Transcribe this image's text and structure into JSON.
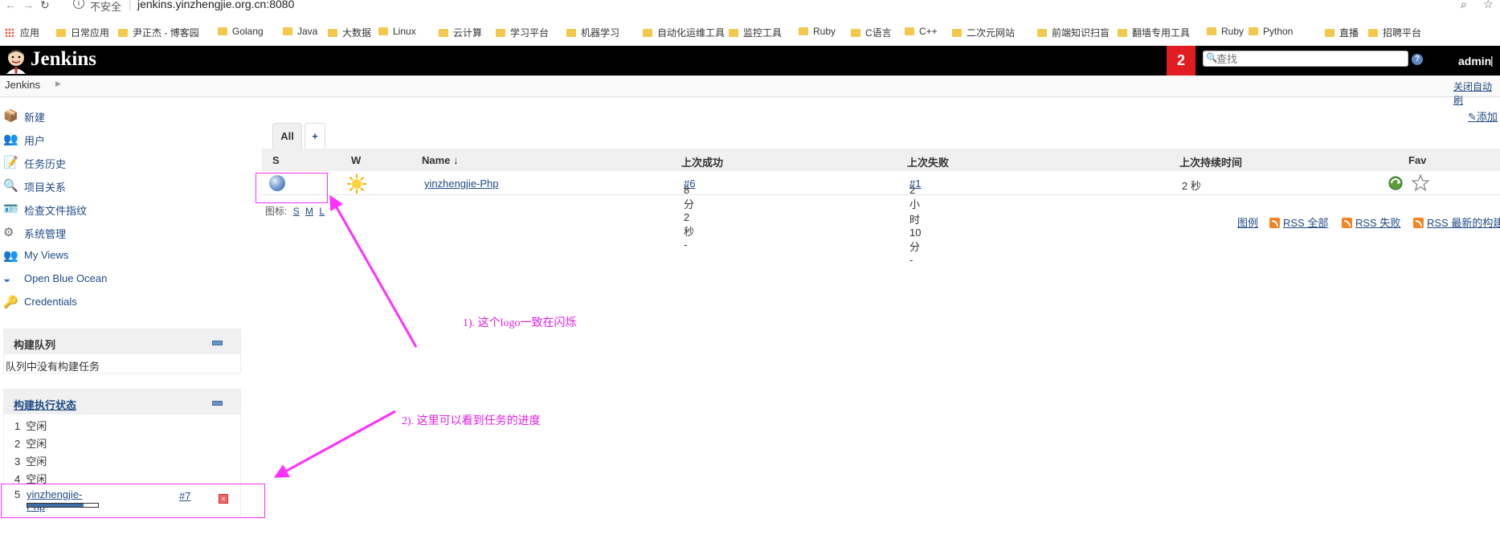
{
  "browser": {
    "insecure_label": "不安全",
    "url": "jenkins.yinzhengjie.org.cn:8080",
    "bookmarks": [
      "应用",
      "日常应用",
      "尹正杰 - 博客园",
      "Golang",
      "Java",
      "大数据",
      "Linux",
      "云计算",
      "学习平台",
      "机器学习",
      "自动化运维工具",
      "监控工具",
      "Ruby",
      "C语言",
      "C++",
      "二次元网站",
      "前端知识扫盲",
      "翻墙专用工具",
      "Ruby",
      "Python",
      "直播",
      "招聘平台"
    ]
  },
  "header": {
    "brand": "Jenkins",
    "notification_count": "2",
    "search_placeholder": "查找",
    "help": "?",
    "user": "admin",
    "bar": "|"
  },
  "breadcrumb": {
    "home": "Jenkins",
    "auto_refresh": "关闭自动刷"
  },
  "sidebar": {
    "tasks": [
      {
        "label": "新建",
        "icon": "package-icon"
      },
      {
        "label": "用户",
        "icon": "users-icon"
      },
      {
        "label": "任务历史",
        "icon": "notepad-icon"
      },
      {
        "label": "项目关系",
        "icon": "magnifier-icon"
      },
      {
        "label": "检查文件指纹",
        "icon": "fingerprint-icon"
      },
      {
        "label": "系统管理",
        "icon": "gear-icon"
      },
      {
        "label": "My Views",
        "icon": "users-icon"
      },
      {
        "label": "Open Blue Ocean",
        "icon": "blue-ocean-icon"
      },
      {
        "label": "Credentials",
        "icon": "credentials-icon"
      }
    ],
    "queue": {
      "title": "构建队列",
      "empty_text": "队列中没有构建任务"
    },
    "executors": {
      "title": "构建执行状态",
      "rows": [
        {
          "num": "1",
          "status": "空闲"
        },
        {
          "num": "2",
          "status": "空闲"
        },
        {
          "num": "3",
          "status": "空闲"
        },
        {
          "num": "4",
          "status": "空闲"
        }
      ],
      "running": {
        "num": "5",
        "job": "yinzhengjie-Php",
        "build": "#7",
        "progress": 0.8
      }
    }
  },
  "main": {
    "tabs": {
      "all": "All",
      "add": "+"
    },
    "add_description": "添加",
    "columns": {
      "s": "S",
      "w": "W",
      "name": "Name ↓",
      "last_success": "上次成功",
      "last_failure": "上次失败",
      "last_duration": "上次持续时间",
      "fav": "Fav"
    },
    "job": {
      "name": "yinzhengjie-Php",
      "last_success": "8 分 2 秒 - ",
      "last_success_build": "#6",
      "last_failure": "2 小时 10 分 - ",
      "last_failure_build": "#1",
      "last_duration": "2 秒"
    },
    "icon_size_label": "图标:",
    "icon_sizes": [
      "S",
      "M",
      "L"
    ],
    "footer_links": [
      "图例",
      "RSS 全部",
      "RSS 失败",
      "RSS 最新的构建"
    ]
  },
  "annotations": {
    "note1": "1). 这个logo一致在闪烁",
    "note2": "2). 这里可以看到任务的进度"
  },
  "colors": {
    "header_bg": "#000000",
    "badge": "#e11d21",
    "link": "#204a87",
    "annotation": "#e020e0"
  }
}
